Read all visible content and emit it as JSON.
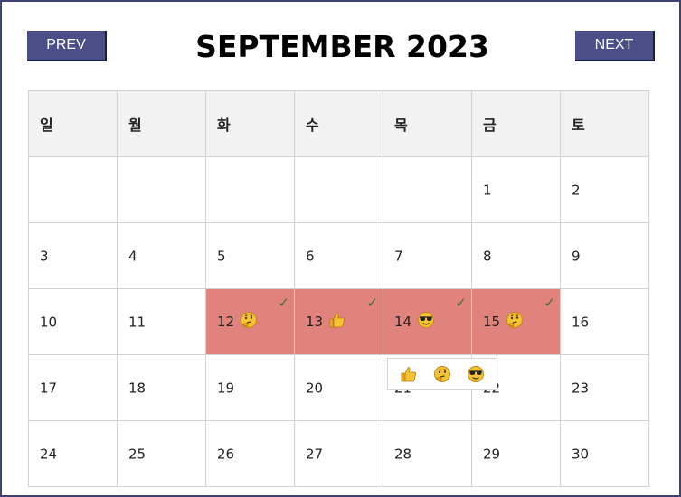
{
  "nav": {
    "prev_label": "PREV",
    "next_label": "NEXT"
  },
  "title": "SEPTEMBER 2023",
  "weekdays": [
    "일",
    "월",
    "화",
    "수",
    "목",
    "금",
    "토"
  ],
  "weeks": [
    [
      {
        "day": ""
      },
      {
        "day": ""
      },
      {
        "day": ""
      },
      {
        "day": ""
      },
      {
        "day": ""
      },
      {
        "day": "1"
      },
      {
        "day": "2"
      }
    ],
    [
      {
        "day": "3"
      },
      {
        "day": "4"
      },
      {
        "day": "5"
      },
      {
        "day": "6"
      },
      {
        "day": "7"
      },
      {
        "day": "8"
      },
      {
        "day": "9"
      }
    ],
    [
      {
        "day": "10"
      },
      {
        "day": "11"
      },
      {
        "day": "12",
        "mood": "thinking-face-icon",
        "checked": true
      },
      {
        "day": "13",
        "mood": "thumbs-up-icon",
        "checked": true
      },
      {
        "day": "14",
        "mood": "sunglasses-face-icon",
        "checked": true
      },
      {
        "day": "15",
        "mood": "thinking-face-icon",
        "checked": true
      },
      {
        "day": "16"
      }
    ],
    [
      {
        "day": "17"
      },
      {
        "day": "18"
      },
      {
        "day": "19"
      },
      {
        "day": "20"
      },
      {
        "day": "21"
      },
      {
        "day": "22"
      },
      {
        "day": "23"
      }
    ],
    [
      {
        "day": "24"
      },
      {
        "day": "25"
      },
      {
        "day": "26"
      },
      {
        "day": "27"
      },
      {
        "day": "28"
      },
      {
        "day": "29"
      },
      {
        "day": "30"
      }
    ]
  ],
  "check_mark": "✓",
  "emoji_picker": [
    "thumbs-up-icon",
    "thinking-face-icon",
    "sunglasses-face-icon"
  ],
  "colors": {
    "marked_bg": "#e0837d",
    "button_bg": "#4a4f8a",
    "header_bg": "#f2f2f2",
    "check": "#4a6a3a"
  }
}
